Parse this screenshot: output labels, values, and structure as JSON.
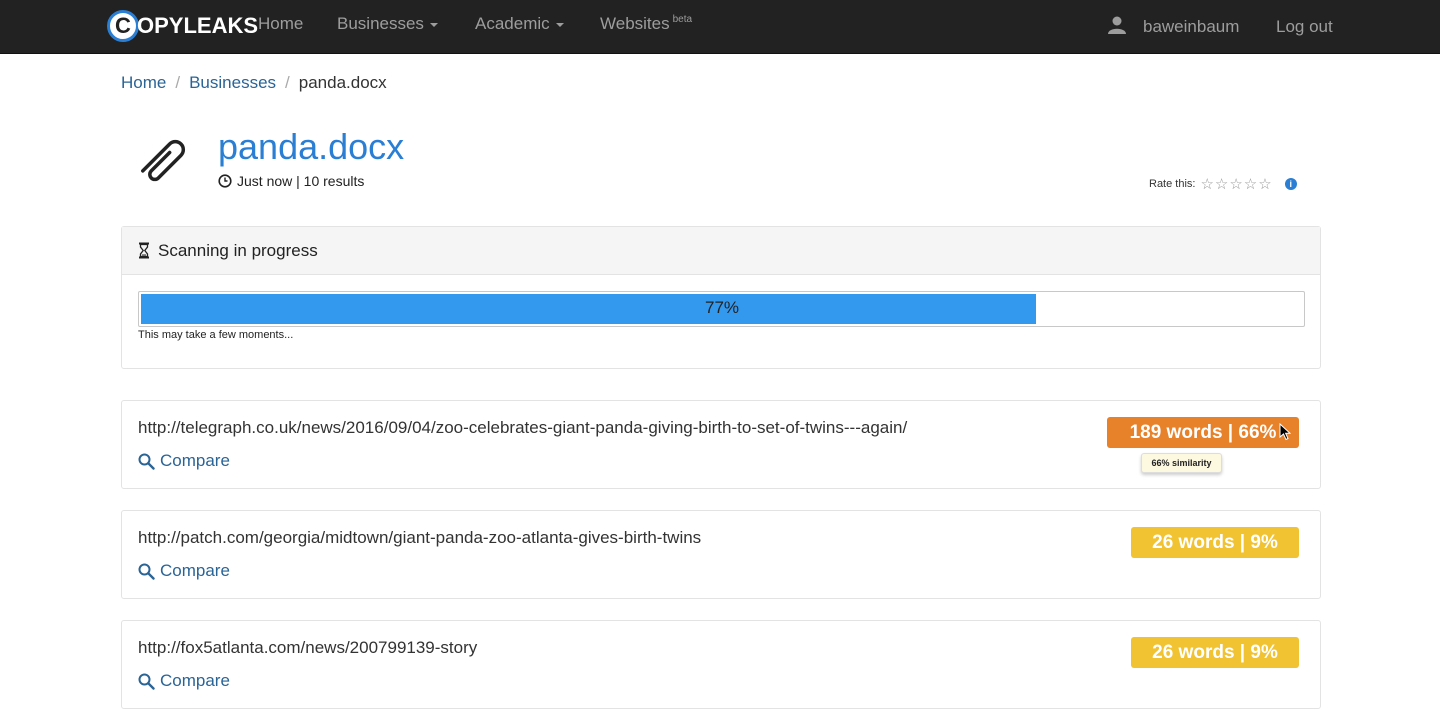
{
  "navbar": {
    "logo_letter": "C",
    "logo_text": "OPYLEAKS",
    "items": [
      {
        "label": "Home"
      },
      {
        "label": "Businesses"
      },
      {
        "label": "Academic"
      },
      {
        "label": "Websites"
      }
    ],
    "websites_badge": "beta",
    "username": "baweinbaum",
    "logout": "Log out"
  },
  "breadcrumb": {
    "home": "Home",
    "businesses": "Businesses",
    "current": "panda.docx"
  },
  "document": {
    "title": "panda.docx",
    "meta": "Just now | 10 results",
    "rate_label": "Rate this:",
    "stars": "☆☆☆☆☆",
    "info": "i"
  },
  "scan": {
    "title": "Scanning in progress",
    "progress_label": "77%",
    "progress_value": 77,
    "note": "This may take a few moments..."
  },
  "results": [
    {
      "url": "http://telegraph.co.uk/news/2016/09/04/zoo-celebrates-giant-panda-giving-birth-to-set-of-twins---again/",
      "compare": "Compare",
      "badge": "189 words | 66%",
      "badge_color": "#e8822a",
      "tooltip": "66% similarity"
    },
    {
      "url": "http://patch.com/georgia/midtown/giant-panda-zoo-atlanta-gives-birth-twins",
      "compare": "Compare",
      "badge": "26 words | 9%",
      "badge_color": "#f1c232"
    },
    {
      "url": "http://fox5atlanta.com/news/200799139-story",
      "compare": "Compare",
      "badge": "26 words | 9%",
      "badge_color": "#f1c232"
    }
  ],
  "colors": {
    "navbar_bg": "#222222",
    "accent": "#2a7fd4",
    "progress": "#3399ee",
    "badge_high": "#e8822a",
    "badge_low": "#f1c232"
  }
}
